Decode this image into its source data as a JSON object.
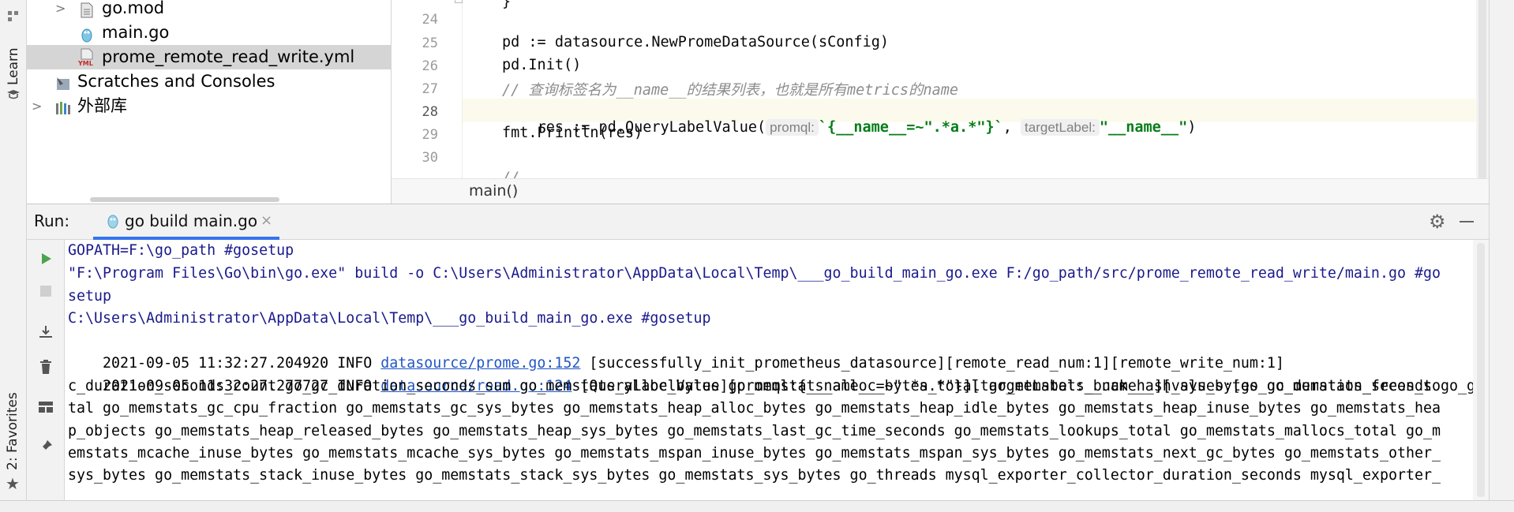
{
  "left_stripe": {
    "learn_label": "Learn",
    "favorites_label": "2: Favorites"
  },
  "project_tree": {
    "items": [
      {
        "label": "go.mod",
        "icon": "file-icon"
      },
      {
        "label": "main.go",
        "icon": "go-file-icon"
      },
      {
        "label": "prome_remote_read_write.yml",
        "icon": "yml-file-icon",
        "icon_text": "YML",
        "selected": true
      },
      {
        "label": "Scratches and Consoles",
        "icon": "scratches-icon"
      },
      {
        "label": "外部库",
        "icon": "library-icon"
      }
    ]
  },
  "editor": {
    "line_numbers": [
      "24",
      "25",
      "26",
      "27",
      "28",
      "29",
      "30"
    ],
    "line25": "pd := datasource.NewPromeDataSource(sConfig)",
    "line26": "pd.Init()",
    "line27": "// 查询标签名为__name__的结果列表，也就是所有metrics的name",
    "line28": {
      "prefix": "res := pd.QueryLabelValue(",
      "hint1": "promql:",
      "arg1": "`{__name__=~\".*a.*\"}`",
      "sep": ", ",
      "hint2": "targetLabel:",
      "arg2": "\"__name__\"",
      "suffix": ")"
    },
    "line29": "fmt.Println(res)",
    "breadcrumb": "main()"
  },
  "run_panel": {
    "label": "Run:",
    "tab_label": "go build main.go",
    "console_lines": [
      "GOPATH=F:\\go_path #gosetup",
      "\"F:\\Program Files\\Go\\bin\\go.exe\" build -o C:\\Users\\Administrator\\AppData\\Local\\Temp\\___go_build_main_go.exe F:/go_path/src/prome_remote_read_write/main.go #go",
      "setup",
      "C:\\Users\\Administrator\\AppData\\Local\\Temp\\___go_build_main_go.exe #gosetup"
    ],
    "log1": {
      "prefix": "2021-09-05 11:32:27.204920 INFO ",
      "link": "datasource/prome.go:152",
      "rest": " [successfully_init_prometheus_datasource][remote_read_num:1][remote_write_num:1]"
    },
    "log2": {
      "prefix": "2021-09-05 11:32:27.277727 INFO ",
      "link": "datasource/read.go:124",
      "rest": " [QueryLabelValue][promql:{__name__=~\".*a.*\"}][targetLabel:__name__][values:[go_gc_duration_seconds go_g"
    },
    "wrapped_lines": [
      "c_duration_seconds_count go_gc_duration_seconds_sum go_memstats_alloc_bytes go_memstats_alloc_bytes_total go_memstats_buck_hash_sys_bytes go_memstats_frees_to",
      "tal go_memstats_gc_cpu_fraction go_memstats_gc_sys_bytes go_memstats_heap_alloc_bytes go_memstats_heap_idle_bytes go_memstats_heap_inuse_bytes go_memstats_hea",
      "p_objects go_memstats_heap_released_bytes go_memstats_heap_sys_bytes go_memstats_last_gc_time_seconds go_memstats_lookups_total go_memstats_mallocs_total go_m",
      "emstats_mcache_inuse_bytes go_memstats_mcache_sys_bytes go_memstats_mspan_inuse_bytes go_memstats_mspan_sys_bytes go_memstats_next_gc_bytes go_memstats_other_",
      "sys_bytes go_memstats_stack_inuse_bytes go_memstats_stack_sys_bytes go_memstats_sys_bytes go_threads mysql_exporter_collector_duration_seconds mysql_exporter_"
    ]
  },
  "colors": {
    "accent": "#3574f0",
    "run_green": "#4da34d",
    "link": "#2156c4",
    "string_green": "#067d17"
  }
}
